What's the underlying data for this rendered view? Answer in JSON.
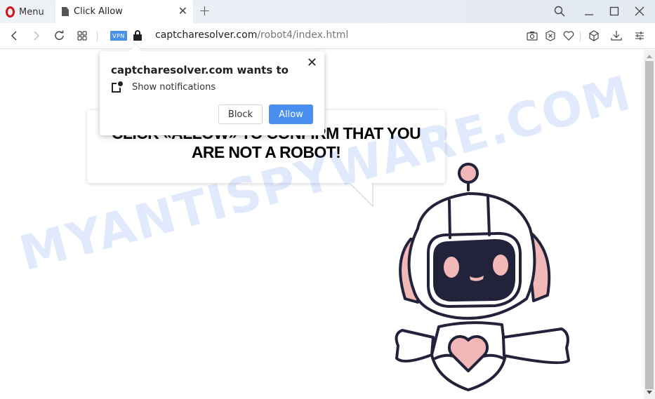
{
  "browser": {
    "menu_label": "Menu",
    "tab": {
      "title": "Click Allow",
      "close_icon": "close-icon"
    },
    "new_tab_icon": "plus-icon",
    "window_controls": [
      "search-icon",
      "minimize-icon",
      "maximize-icon",
      "close-icon"
    ]
  },
  "address_bar": {
    "vpn_badge": "VPN",
    "url_domain": "captcharesolver.com",
    "url_path": "/robot4/index.html",
    "nav_icons": [
      "back-icon",
      "forward-icon",
      "reload-icon",
      "speed-dial-icon"
    ],
    "toolbar_icons": [
      "camera-icon",
      "adblock-icon",
      "heart-icon",
      "cube-icon",
      "download-icon",
      "settings-sliders-icon"
    ]
  },
  "permission_popup": {
    "title": "captcharesolver.com wants to",
    "permission": "Show notifications",
    "block_label": "Block",
    "allow_label": "Allow",
    "close_label": "✕"
  },
  "page": {
    "heading_line1": "CLICK «ALLOW» TO CONFIRM THAT YOU",
    "heading_line2": "ARE NOT A ROBOT!",
    "watermark": "MYANTISPYWARE.COM"
  },
  "colors": {
    "accent": "#4a8ff0",
    "vpn": "#4a90e8",
    "opera_red": "#d4121a",
    "robot_outline": "#22223b",
    "robot_pink": "#f2b8b8"
  }
}
